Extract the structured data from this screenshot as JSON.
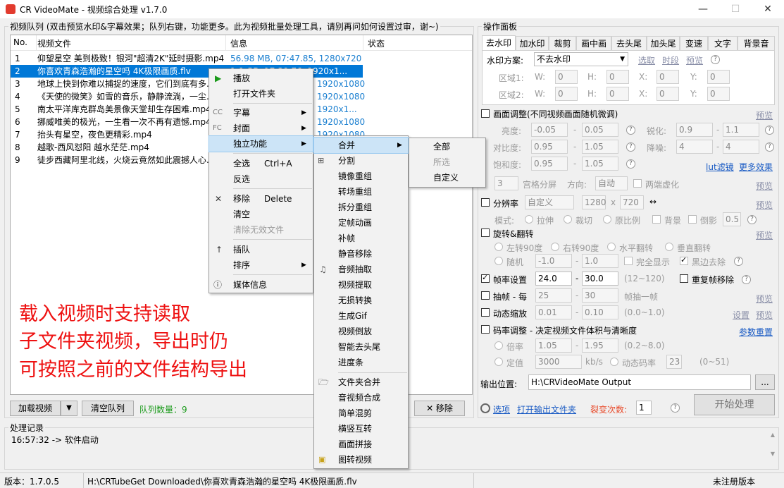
{
  "window": {
    "title": "CR VideoMate - 视频综合处理 v1.7.0",
    "min": "—",
    "max": "☐",
    "close": "✕"
  },
  "queue": {
    "title": "视频队列 (双击预览水印&字幕效果；队列右键，功能更多。此为视频批量处理工具，请别再问如何设置过审，谢~)",
    "cols": [
      "No.",
      "视频文件",
      "信息",
      "状态"
    ],
    "rows": [
      {
        "no": "1",
        "file": "仰望星空 美到极致！银河\"超清2K\"延时摄影.mp4",
        "info": "56.98 MB, 07:47.85, 1280x720"
      },
      {
        "no": "2",
        "file": "你喜欢青森浩瀚的星空吗 4K极限画质.flv",
        "info": "1.9 GB, 17:39.76, 1920x1..."
      },
      {
        "no": "3",
        "file": "地球上快到你难以捕捉的速度，它们到底有多...",
        "info": "1920x1080"
      },
      {
        "no": "4",
        "file": "《天使的微笑》如雪的音乐，静静流淌，一尘...",
        "info": "1920x1080"
      },
      {
        "no": "5",
        "file": "南太平洋库克群岛美景像天堂却生存困难.mp4",
        "info": "1920x1..."
      },
      {
        "no": "6",
        "file": "挪威唯美的极光，一生看一次不再有遗憾.mp4",
        "info": "1920x1080"
      },
      {
        "no": "7",
        "file": "抬头有星空，夜色更精彩.mp4",
        "info": "1920x1080"
      },
      {
        "no": "8",
        "file": "越歌-西风怼阳 越水茫茫.mp4",
        "info": "1920x1080"
      },
      {
        "no": "9",
        "file": "徒步西藏阿里北线，火烧云竟然如此震撼人心...",
        "info": ""
      }
    ],
    "promo": [
      "载入视频时支持读取",
      "子文件夹视频，导出时仍",
      "可按照之前的文件结构导出"
    ],
    "load_btn": "加载视频",
    "dropdown": "▼",
    "clear_btn": "清空队列",
    "count": "队列数量：9",
    "remove_btn": "✕ 移除"
  },
  "context_menu": {
    "items": [
      {
        "icon": "▶",
        "label": "播放"
      },
      {
        "label": "打开文件夹"
      },
      {
        "icon": "CC",
        "label": "字幕",
        "arrow": "▶"
      },
      {
        "icon": "FC",
        "label": "封面",
        "arrow": "▶"
      },
      {
        "label": "独立功能",
        "arrow": "▶"
      },
      {
        "label": "全选",
        "shortcut": "Ctrl+A"
      },
      {
        "label": "反选"
      },
      {
        "icon": "✕",
        "label": "移除",
        "shortcut": "Delete"
      },
      {
        "label": "清空"
      },
      {
        "label": "清除无效文件"
      },
      {
        "icon": "↑",
        "label": "插队"
      },
      {
        "label": "排序",
        "arrow": "▶"
      },
      {
        "icon": "ⓘ",
        "label": "媒体信息"
      }
    ]
  },
  "submenu": {
    "items": [
      "合并",
      "分割",
      "镜像重组",
      "转场重组",
      "拆分重组",
      "定帧动画",
      "补帧",
      "静音移除",
      "音频抽取",
      "视频提取",
      "无损转换",
      "生成Gif",
      "视频倒放",
      "智能去头尾",
      "进度条",
      "文件夹合并",
      "音视频合成",
      "简单混剪",
      "横竖互转",
      "画面拼接",
      "图转视频"
    ],
    "arrow": "▶"
  },
  "merge_menu": {
    "items": [
      "全部",
      "所选",
      "自定义"
    ]
  },
  "panel": {
    "title": "操作面板",
    "tabs": [
      "去水印",
      "加水印",
      "裁剪",
      "画中画",
      "去头尾",
      "加头尾",
      "变速",
      "文字",
      "背景音"
    ],
    "wm_label": "水印方案:",
    "wm_value": "不去水印",
    "wm_links": [
      "选取",
      "时段",
      "预览"
    ],
    "area1": "区域1:",
    "area2": "区域2:",
    "W": "W:",
    "H": "H:",
    "X": "X:",
    "Y": "Y:",
    "zero": "0",
    "adjust": "画面调整(不同视频画面随机微调)",
    "preview": "预览",
    "brightness": "亮度:",
    "contrast": "对比度:",
    "saturation": "饱和度:",
    "sharpen": "锐化:",
    "denoise": "降噪:",
    "b1": "-0.05",
    "b2": "0.05",
    "c1": "0.95",
    "c2": "1.05",
    "s1": "0.95",
    "s2": "1.05",
    "sh1": "0.9",
    "sh2": "1.1",
    "d1": "4",
    "d2": "4",
    "lut": "lut滤镜",
    "more": "更多效果",
    "dash": "-",
    "grid_val": "3",
    "grid": "宫格分屏",
    "dir": "方向:",
    "dir_val": "自动",
    "blur": "两端虚化",
    "res": "分辨率",
    "res_val": "自定义",
    "res_w": "1280",
    "res_x": "x",
    "res_h": "720",
    "arrows": "↔",
    "mode": "模式:",
    "stretch": "拉伸",
    "crop": "裁切",
    "orig": "原比例",
    "bg": "背景",
    "reflect": "倒影",
    "reflect_val": "0.5",
    "rotate": "旋转&翻转",
    "left90": "左转90度",
    "right90": "右转90度",
    "hflip": "水平翻转",
    "vflip": "垂直翻转",
    "random": "随机",
    "r1": "-1.0",
    "r2": "1.0",
    "full": "完全显示",
    "blackedge": "黑边去除",
    "fps": "帧率设置",
    "fps1": "24.0",
    "fps2": "30.0",
    "fps_range": "(12~120)",
    "dup": "重复帧移除",
    "drop": "抽帧 - 每",
    "drop1": "25",
    "drop2": "30",
    "drop_txt": "帧抽一帧",
    "zoom": "动态缩放",
    "z1": "0.01",
    "z2": "0.10",
    "z_range": "(0.0~1.0)",
    "settings": "设置",
    "bitrate": "码率调整 - 决定视频文件体积与清晰度",
    "params": "参数重置",
    "mult": "倍率",
    "m1": "1.05",
    "m2": "1.95",
    "m_range": "(0.2~8.0)",
    "fixed": "定值",
    "fixed_val": "3000",
    "kbs": "kb/s",
    "dyn": "动态码率",
    "dyn_val": "23",
    "dyn_range": "(0~51)",
    "out_label": "输出位置:",
    "out_path": "H:\\CRVideoMate Output",
    "browse": "...",
    "options": "选项",
    "open_out": "打开输出文件夹",
    "split": "裂变次数:",
    "split_val": "1",
    "start": "开始处理"
  },
  "log": {
    "title": "处理记录",
    "line": "16:57:32 -> 软件启动"
  },
  "status": {
    "version": "版本：1.7.0.5",
    "path": "H:\\CRTubeGet Downloaded\\你喜欢青森浩瀚的星空吗 4K极限画质.flv",
    "reg": "未注册版本"
  }
}
